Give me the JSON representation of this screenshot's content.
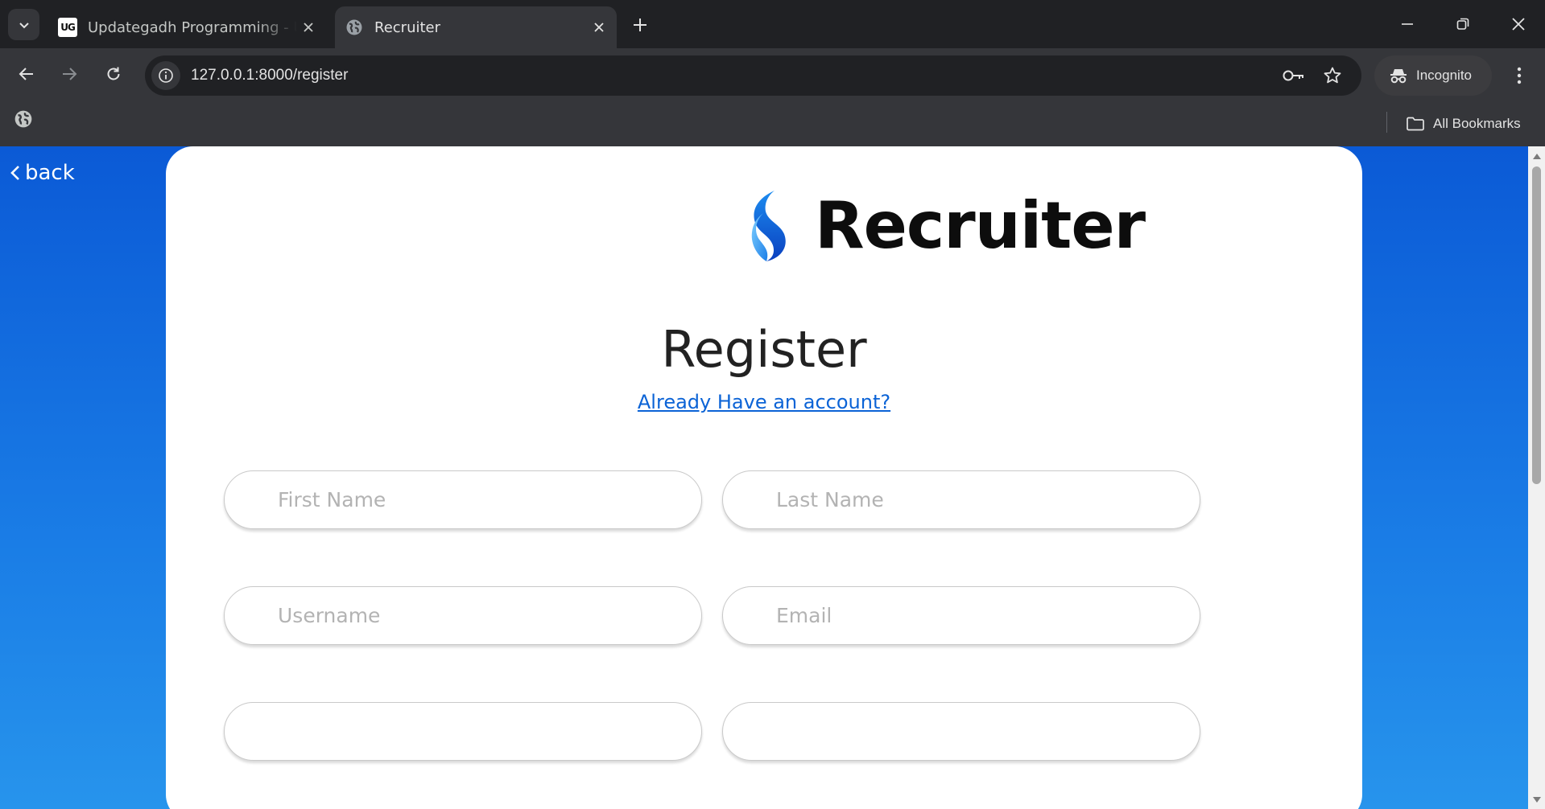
{
  "browser": {
    "tabs": [
      {
        "title": "Updategadh Programming - Up",
        "favicon_text": "UG",
        "active": false
      },
      {
        "title": "Recruiter",
        "favicon": "globe-icon",
        "active": true
      }
    ],
    "url": "127.0.0.1:8000/register",
    "incognito_label": "Incognito",
    "bookmarks_label": "All Bookmarks"
  },
  "page": {
    "back_label": "back",
    "brand": "Recruiter",
    "heading": "Register",
    "login_link": "Already Have an account?",
    "fields": {
      "first_name": {
        "placeholder": "First Name",
        "value": ""
      },
      "last_name": {
        "placeholder": "Last Name",
        "value": ""
      },
      "username": {
        "placeholder": "Username",
        "value": ""
      },
      "email": {
        "placeholder": "Email",
        "value": ""
      },
      "field5": {
        "placeholder": "",
        "value": ""
      },
      "field6": {
        "placeholder": "",
        "value": ""
      }
    }
  },
  "colors": {
    "accent": "#0b63d6",
    "background_top": "#0b5ad6",
    "background_bottom": "#2794ec",
    "chrome_dark": "#202124",
    "chrome_toolbar": "#35363a"
  }
}
